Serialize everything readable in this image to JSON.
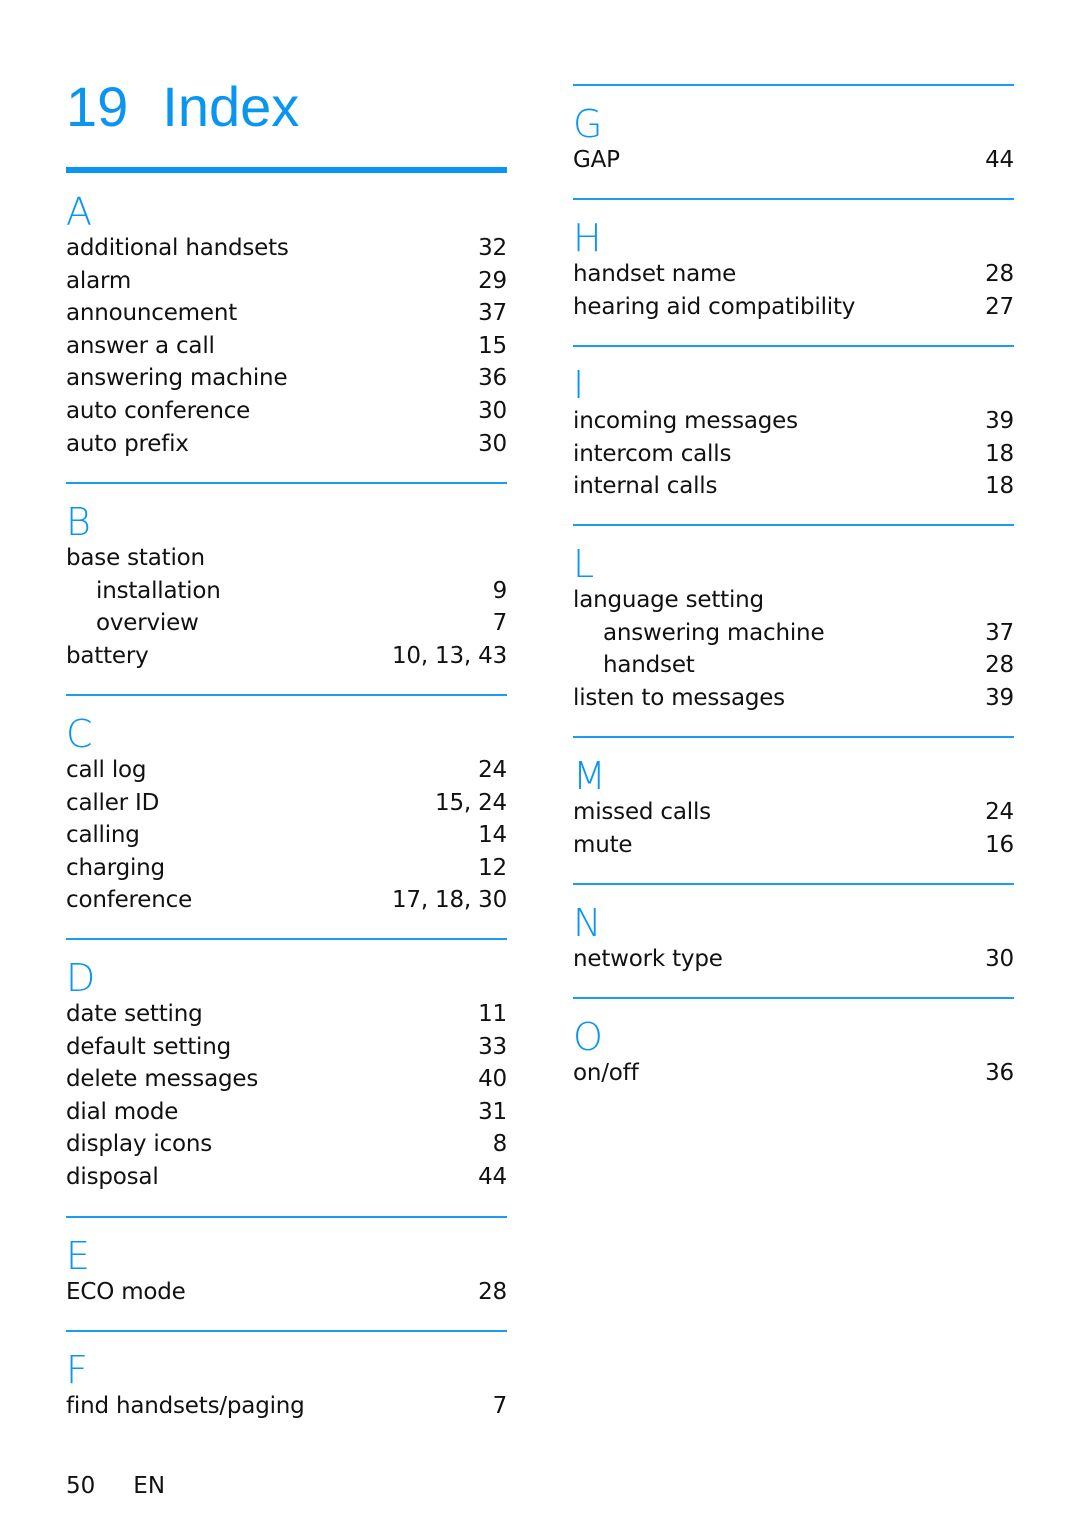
{
  "header": {
    "chapter_number": "19",
    "title": "Index"
  },
  "accent_color": "#0a96f0",
  "left_sections": [
    {
      "letter": "A",
      "entries": [
        {
          "term": "additional handsets",
          "pages": "32"
        },
        {
          "term": "alarm",
          "pages": "29"
        },
        {
          "term": "announcement",
          "pages": "37"
        },
        {
          "term": "answer a call",
          "pages": "15"
        },
        {
          "term": "answering machine",
          "pages": "36"
        },
        {
          "term": "auto conference",
          "pages": "30"
        },
        {
          "term": "auto prefix",
          "pages": "30"
        }
      ]
    },
    {
      "letter": "B",
      "entries": [
        {
          "term": "base station",
          "pages": ""
        },
        {
          "term": "installation",
          "pages": "9",
          "sub": true
        },
        {
          "term": "overview",
          "pages": "7",
          "sub": true
        },
        {
          "term": "battery",
          "pages": "10, 13, 43"
        }
      ]
    },
    {
      "letter": "C",
      "entries": [
        {
          "term": "call log",
          "pages": "24"
        },
        {
          "term": "caller ID",
          "pages": "15, 24"
        },
        {
          "term": "calling",
          "pages": "14"
        },
        {
          "term": "charging",
          "pages": "12"
        },
        {
          "term": "conference",
          "pages": "17, 18, 30"
        }
      ]
    },
    {
      "letter": "D",
      "entries": [
        {
          "term": "date setting",
          "pages": "11"
        },
        {
          "term": "default setting",
          "pages": "33"
        },
        {
          "term": "delete messages",
          "pages": "40"
        },
        {
          "term": "dial mode",
          "pages": "31"
        },
        {
          "term": "display icons",
          "pages": "8"
        },
        {
          "term": "disposal",
          "pages": "44"
        }
      ]
    },
    {
      "letter": "E",
      "entries": [
        {
          "term": "ECO mode",
          "pages": "28"
        }
      ]
    },
    {
      "letter": "F",
      "entries": [
        {
          "term": "find handsets/paging",
          "pages": "7"
        }
      ]
    }
  ],
  "right_sections": [
    {
      "letter": "G",
      "entries": [
        {
          "term": "GAP",
          "pages": "44"
        }
      ]
    },
    {
      "letter": "H",
      "entries": [
        {
          "term": "handset name",
          "pages": "28"
        },
        {
          "term": "hearing aid compatibility",
          "pages": "27"
        }
      ]
    },
    {
      "letter": "I",
      "entries": [
        {
          "term": "incoming messages",
          "pages": "39"
        },
        {
          "term": "intercom calls",
          "pages": "18"
        },
        {
          "term": "internal calls",
          "pages": "18"
        }
      ]
    },
    {
      "letter": "L",
      "entries": [
        {
          "term": "language setting",
          "pages": ""
        },
        {
          "term": "answering machine",
          "pages": "37",
          "sub": true
        },
        {
          "term": "handset",
          "pages": "28",
          "sub": true
        },
        {
          "term": "listen to messages",
          "pages": "39"
        }
      ]
    },
    {
      "letter": "M",
      "entries": [
        {
          "term": "missed calls",
          "pages": "24"
        },
        {
          "term": "mute",
          "pages": "16"
        }
      ]
    },
    {
      "letter": "N",
      "entries": [
        {
          "term": "network type",
          "pages": "30"
        }
      ]
    },
    {
      "letter": "O",
      "entries": [
        {
          "term": "on/off",
          "pages": "36"
        }
      ]
    }
  ],
  "footer": {
    "page_number": "50",
    "language": "EN"
  }
}
